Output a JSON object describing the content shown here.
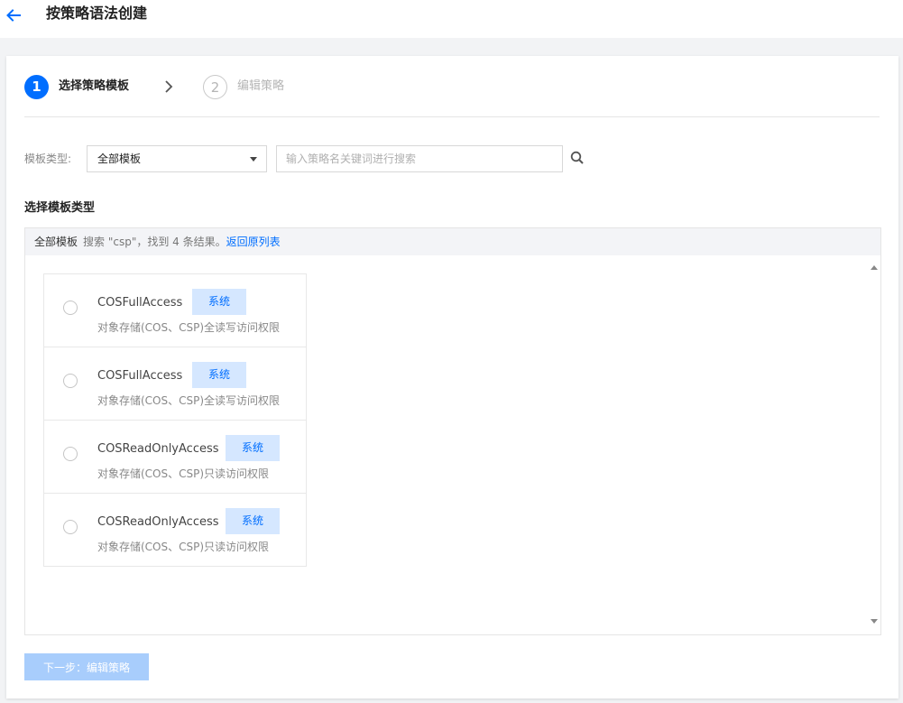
{
  "header": {
    "title": "按策略语法创建",
    "back_icon": "arrow-left-icon"
  },
  "steps": [
    {
      "number": "1",
      "label": "选择策略模板",
      "state": "active"
    },
    {
      "number": "2",
      "label": "编辑策略",
      "state": "inactive"
    }
  ],
  "filters": {
    "type_label": "模板类型:",
    "type_value": "全部模板",
    "search_placeholder": "输入策略名关键词进行搜索"
  },
  "section": {
    "title": "选择模板类型"
  },
  "results": {
    "category": "全部模板",
    "summary": "搜索 \"csp\"，找到 4 条结果。",
    "back_link": "返回原列表",
    "items": [
      {
        "name": "COSFullAccess",
        "tag": "系统",
        "desc": "对象存储(COS、CSP)全读写访问权限"
      },
      {
        "name": "COSFullAccess",
        "tag": "系统",
        "desc": "对象存储(COS、CSP)全读写访问权限"
      },
      {
        "name": "COSReadOnlyAccess",
        "tag": "系统",
        "desc": "对象存储(COS、CSP)只读访问权限"
      },
      {
        "name": "COSReadOnlyAccess",
        "tag": "系统",
        "desc": "对象存储(COS、CSP)只读访问权限"
      }
    ]
  },
  "footer": {
    "next_label": "下一步：编辑策略"
  },
  "colors": {
    "primary": "#006eff",
    "tag_bg": "#d5e7ff",
    "disabled_button": "#a8cdfc"
  }
}
